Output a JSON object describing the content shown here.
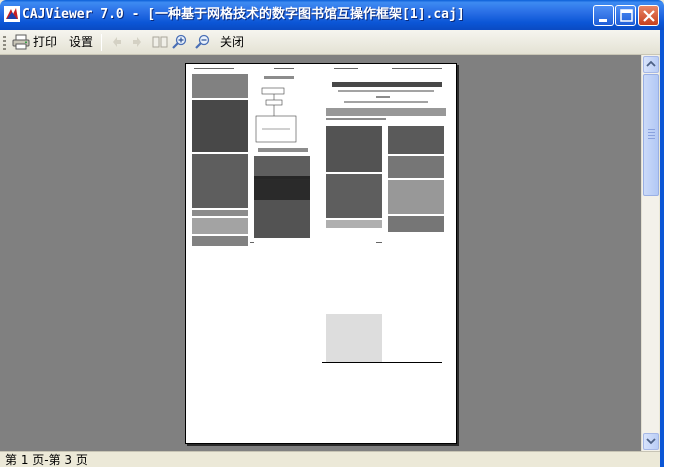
{
  "window": {
    "title": "CAJViewer 7.0 - [一种基于网格技术的数字图书馆互操作框架[1].caj]"
  },
  "title_buttons": {
    "minimize": "minimize",
    "maximize": "maximize",
    "close": "close"
  },
  "toolbar": {
    "print_label": "打印",
    "settings_label": "设置",
    "close_label": "关闭"
  },
  "status": {
    "page_info": "第 1 页-第 3 页"
  },
  "colors": {
    "titlebar": "#2a6fe6",
    "workspace": "#808080",
    "page": "#ffffff"
  }
}
